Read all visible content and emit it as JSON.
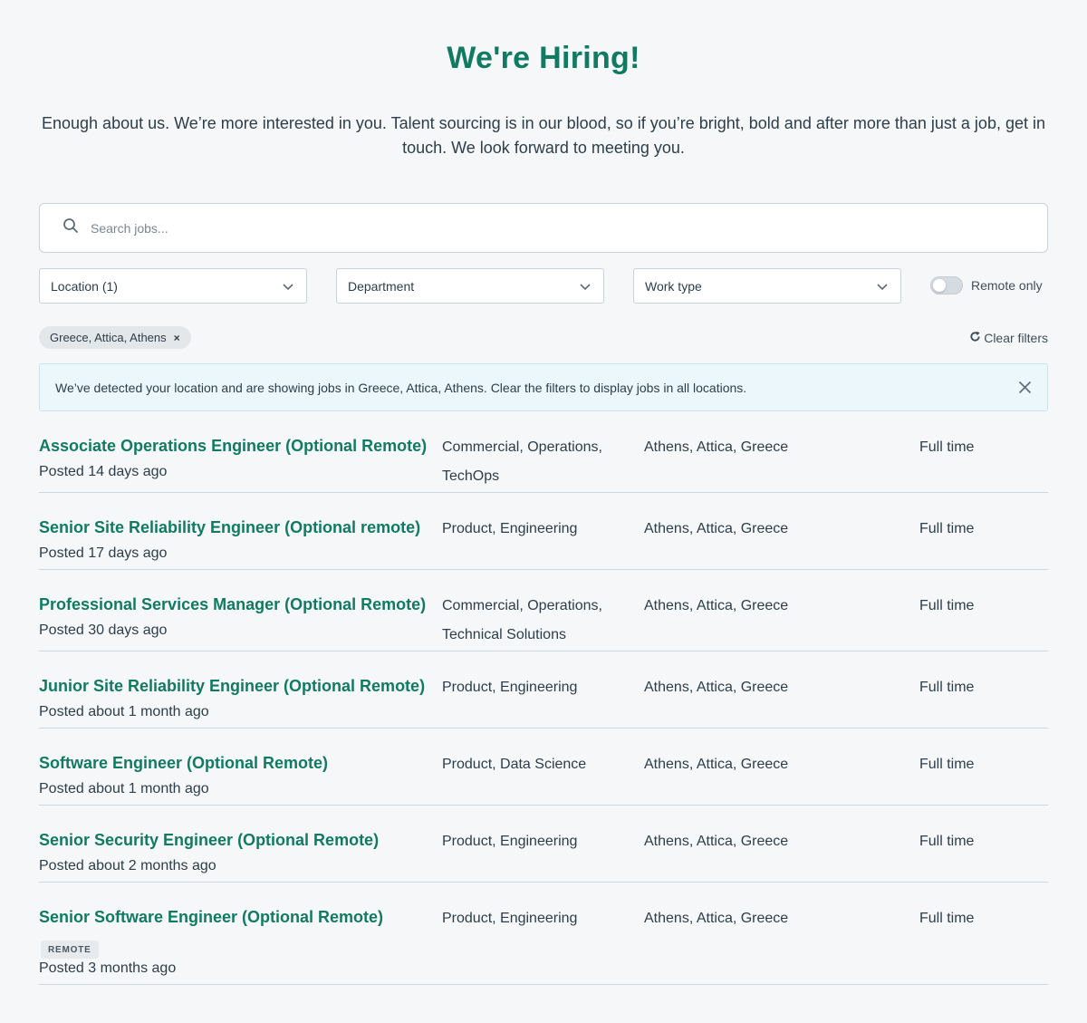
{
  "header": {
    "title": "We're Hiring!",
    "intro": "Enough about us. We’re more interested in you. Talent sourcing is in our blood, so if you’re bright, bold and after more than just a job, get in touch. We look forward to meeting you."
  },
  "search": {
    "placeholder": "Search jobs...",
    "icon": "search-icon"
  },
  "filters": {
    "location_label": "Location (1)",
    "department_label": "Department",
    "work_type_label": "Work type",
    "remote_only_label": "Remote only",
    "remote_only_on": false
  },
  "active_filters": {
    "chip_label": "Greece, Attica, Athens",
    "chip_remove": "×",
    "clear_label": "Clear filters"
  },
  "banner": {
    "text": "We’ve detected your location and are showing jobs in Greece, Attica, Athens. Clear the filters to display jobs in all locations."
  },
  "colors": {
    "accent": "#117a63",
    "background": "#f6f7f8",
    "banner_bg": "#ecf7fb"
  },
  "jobs": [
    {
      "title": "Associate Operations Engineer (Optional Remote)",
      "posted": "Posted 14 days ago",
      "dept_line1": "Commercial, Operations,",
      "dept_line2": "TechOps",
      "location": "Athens, Attica, Greece",
      "type": "Full time"
    },
    {
      "title": "Senior Site Reliability Engineer (Optional remote)",
      "posted": "Posted 17 days ago",
      "dept_line1": "Product, Engineering",
      "dept_line2": "",
      "location": "Athens, Attica, Greece",
      "type": "Full time"
    },
    {
      "title": "Professional Services Manager (Optional Remote)",
      "posted": "Posted 30 days ago",
      "dept_line1": "Commercial, Operations,",
      "dept_line2": "Technical Solutions",
      "location": "Athens, Attica, Greece",
      "type": "Full time"
    },
    {
      "title": "Junior Site Reliability Engineer (Optional Remote)",
      "posted": "Posted about 1 month ago",
      "dept_line1": "Product, Engineering",
      "dept_line2": "",
      "location": "Athens, Attica, Greece",
      "type": "Full time"
    },
    {
      "title": "Software Engineer (Optional Remote)",
      "posted": "Posted about 1 month ago",
      "dept_line1": "Product, Data Science",
      "dept_line2": "",
      "location": "Athens, Attica, Greece",
      "type": "Full time"
    },
    {
      "title": "Senior Security Engineer (Optional Remote)",
      "posted": "Posted about 2 months ago",
      "dept_line1": "Product, Engineering",
      "dept_line2": "",
      "location": "Athens, Attica, Greece",
      "type": "Full time"
    },
    {
      "title": "Senior Software Engineer (Optional Remote)",
      "badge": "REMOTE",
      "posted": "Posted 3 months ago",
      "dept_line1": "Product, Engineering",
      "dept_line2": "",
      "location": "Athens, Attica, Greece",
      "type": "Full time"
    }
  ]
}
